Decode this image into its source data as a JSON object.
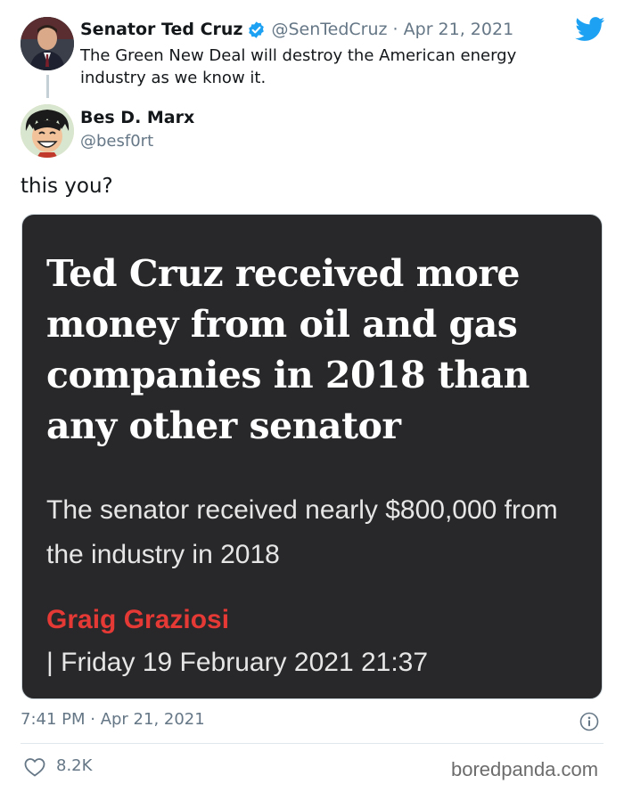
{
  "quoted_tweet": {
    "name": "Senator Ted Cruz",
    "handle": "@SenTedCruz",
    "separator": "·",
    "date": "Apr 21, 2021",
    "text": "The Green New Deal will destroy the American energy industry as we know it.",
    "verified": true
  },
  "reply_tweet": {
    "name": "Bes D. Marx",
    "handle": "@besf0rt",
    "text": "this you?"
  },
  "article_card": {
    "headline": "Ted Cruz received more money from oil and gas companies in 2018 than any other senator",
    "subheadline": "The senator received nearly $800,000 from the industry in 2018",
    "author": "Graig Graziosi",
    "dateline": "| Friday 19 February 2021 21:37"
  },
  "footer": {
    "timestamp": "7:41 PM · Apr 21, 2021",
    "likes": "8.2K",
    "watermark": "boredpanda.com"
  },
  "icons": {
    "brand": "twitter-bird-icon",
    "verified": "verified-badge-icon",
    "info": "info-icon",
    "like": "heart-icon"
  },
  "colors": {
    "twitter_blue": "#1da1f2",
    "text_secondary": "#657786",
    "card_background": "#28282a",
    "author_red": "#e53935"
  }
}
